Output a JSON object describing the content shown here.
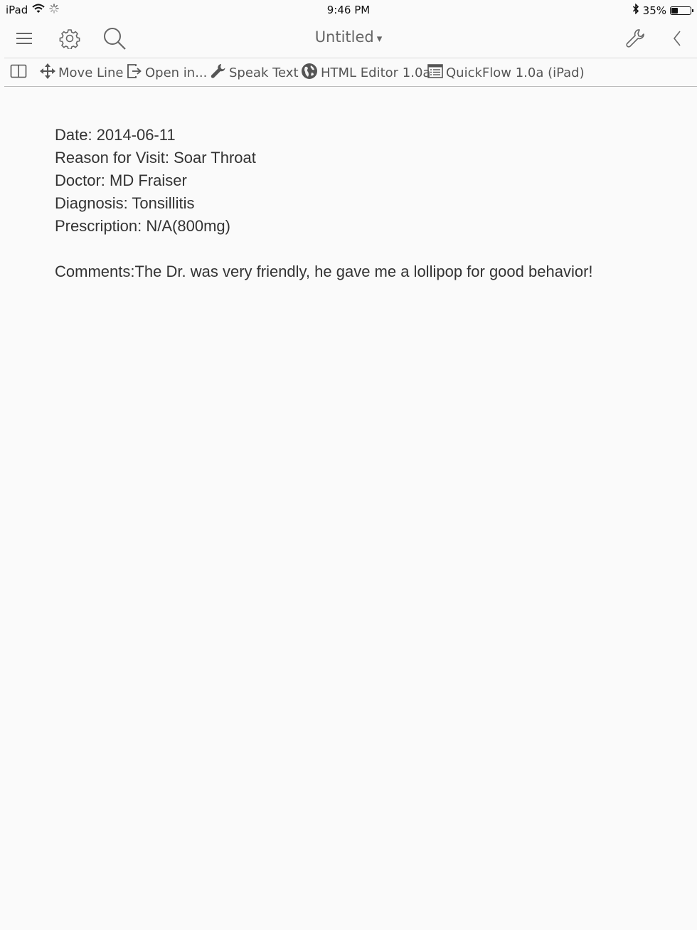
{
  "status_bar": {
    "device": "iPad",
    "time": "9:46 PM",
    "battery": "35%",
    "battery_level": 0.35
  },
  "nav": {
    "title": "Untitled",
    "title_caret": "▾",
    "icons": [
      "menu-icon",
      "gear-icon",
      "search-icon",
      "wrench-icon",
      "chevron-left-icon"
    ]
  },
  "toolbar": {
    "items": [
      {
        "icon": "split-view-icon",
        "label": ""
      },
      {
        "icon": "move-arrows-icon",
        "label": "Move Line"
      },
      {
        "icon": "open-in-icon",
        "label": "Open in..."
      },
      {
        "icon": "wrench-icon",
        "label": "Speak Text"
      },
      {
        "icon": "globe-icon",
        "label": "HTML Editor 1.0a"
      },
      {
        "icon": "list-window-icon",
        "label": "QuickFlow 1.0a (iPad)"
      }
    ]
  },
  "document": {
    "lines": [
      "Date: 2014-06-11",
      "Reason for Visit: Soar Throat",
      "Doctor: MD Fraiser",
      "Diagnosis: Tonsillitis",
      "Prescription: N/A(800mg)",
      "",
      "Comments:The Dr. was very friendly, he gave me a lollipop for good behavior!"
    ]
  }
}
